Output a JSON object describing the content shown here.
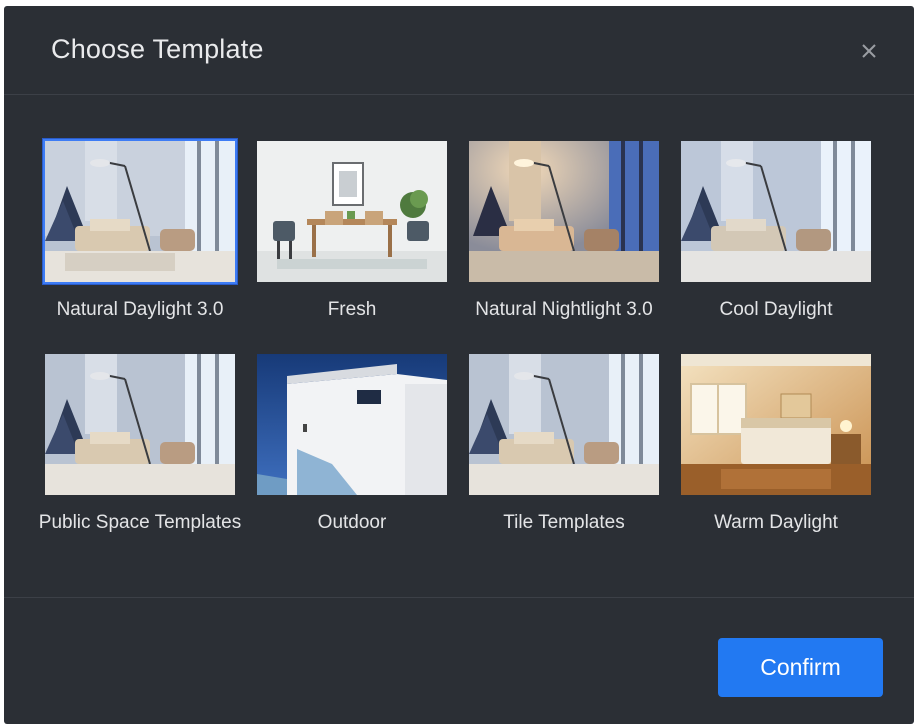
{
  "dialog": {
    "title": "Choose Template",
    "close_icon": "close-icon"
  },
  "templates": [
    {
      "label": "Natural Daylight 3.0",
      "selected": true,
      "scene": "living-room-daylight"
    },
    {
      "label": "Fresh",
      "selected": false,
      "scene": "dining-room"
    },
    {
      "label": "Natural Nightlight 3.0",
      "selected": false,
      "scene": "living-room-night"
    },
    {
      "label": "Cool Daylight",
      "selected": false,
      "scene": "living-room-cool"
    },
    {
      "label": "Public Space Templates",
      "selected": false,
      "scene": "living-room-daylight"
    },
    {
      "label": "Outdoor",
      "selected": false,
      "scene": "outdoor-building"
    },
    {
      "label": "Tile Templates",
      "selected": false,
      "scene": "living-room-daylight"
    },
    {
      "label": "Warm Daylight",
      "selected": false,
      "scene": "bedroom-warm"
    }
  ],
  "footer": {
    "confirm_label": "Confirm"
  },
  "colors": {
    "dialog_bg": "#2b2f35",
    "accent": "#2279f2",
    "selected_border": "#3d7cf5"
  }
}
